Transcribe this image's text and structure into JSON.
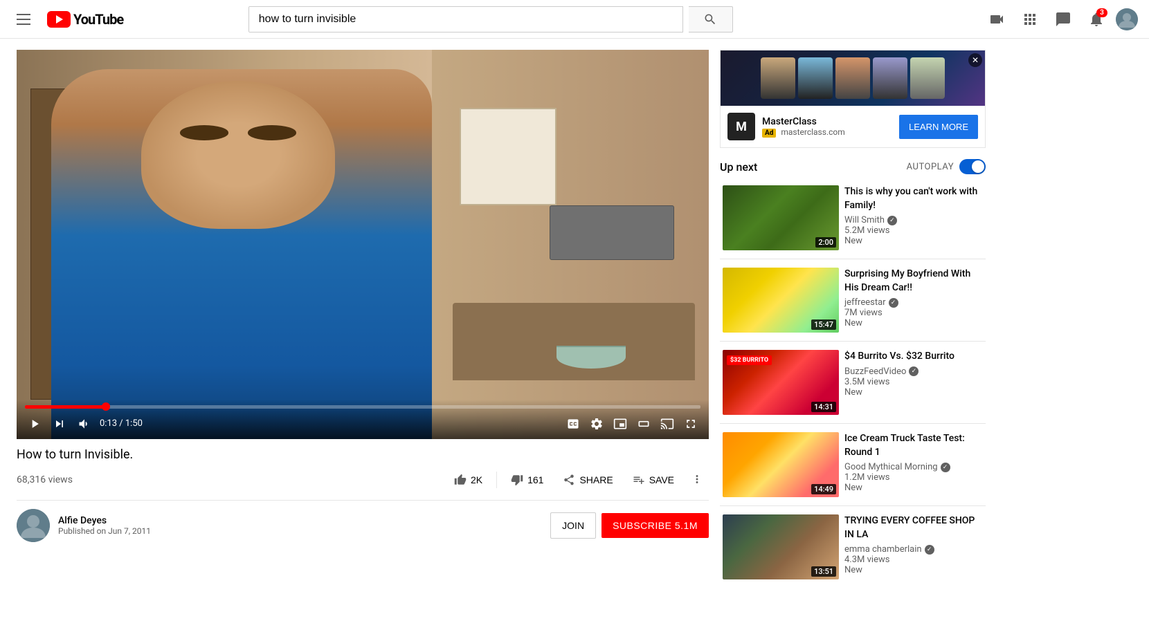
{
  "header": {
    "logo_text": "YouTube",
    "search_placeholder": "how to turn invisible",
    "search_value": "how to turn invisible"
  },
  "video": {
    "title": "How to turn Invisible.",
    "views": "68,316 views",
    "likes": "2K",
    "dislikes": "161",
    "share_label": "SHARE",
    "save_label": "SAVE",
    "time_current": "0:13",
    "time_total": "1:50",
    "time_display": "0:13 / 1:50",
    "progress_percent": 12
  },
  "channel": {
    "name": "Alfie Deyes",
    "published": "Published on Jun 7, 2011",
    "subscribers": "5.1M",
    "join_label": "JOIN",
    "subscribe_label": "SUBSCRIBE  5.1M"
  },
  "ad": {
    "channel": "MasterClass",
    "url": "masterclass.com",
    "badge": "Ad",
    "learn_more": "LEARN MORE"
  },
  "sidebar": {
    "up_next": "Up next",
    "autoplay": "AUTOPLAY",
    "videos": [
      {
        "title": "This is why you can't work with Family!",
        "channel": "Will Smith",
        "views": "5.2M views",
        "new_label": "New",
        "duration": "2:00",
        "verified": true,
        "thumb_class": "thumb-bg-1"
      },
      {
        "title": "Surprising My Boyfriend With His Dream Car!!",
        "channel": "jeffreestar",
        "views": "7M views",
        "new_label": "New",
        "duration": "15:47",
        "verified": true,
        "thumb_class": "thumb-bg-2",
        "price_label": ""
      },
      {
        "title": "$4 Burrito Vs. $32 Burrito",
        "channel": "BuzzFeedVideo",
        "views": "3.5M views",
        "new_label": "New",
        "duration": "14:31",
        "verified": true,
        "thumb_class": "thumb-bg-3",
        "price_label": "$32 BURRITO"
      },
      {
        "title": "Ice Cream Truck Taste Test: Round 1",
        "channel": "Good Mythical Morning",
        "views": "1.2M views",
        "new_label": "New",
        "duration": "14:49",
        "verified": true,
        "thumb_class": "thumb-bg-4"
      },
      {
        "title": "TRYING EVERY COFFEE SHOP IN LA",
        "channel": "emma chamberlain",
        "views": "4.3M views",
        "new_label": "New",
        "duration": "13:51",
        "verified": true,
        "thumb_class": "thumb-bg-5"
      }
    ]
  },
  "icons": {
    "play": "▶",
    "next": "⏭",
    "volume": "🔊",
    "cc": "CC",
    "settings": "⚙",
    "miniplayer": "⧉",
    "theater": "▭",
    "cast": "⊡",
    "fullscreen": "⛶",
    "like": "👍",
    "dislike": "👎",
    "share_icon": "➦",
    "save_icon": "≡+",
    "more": "…",
    "menu": "☰",
    "search": "🔍",
    "upload": "📹",
    "apps": "⋮⋮⋮",
    "message": "💬",
    "bell": "🔔",
    "verified": "✓"
  }
}
